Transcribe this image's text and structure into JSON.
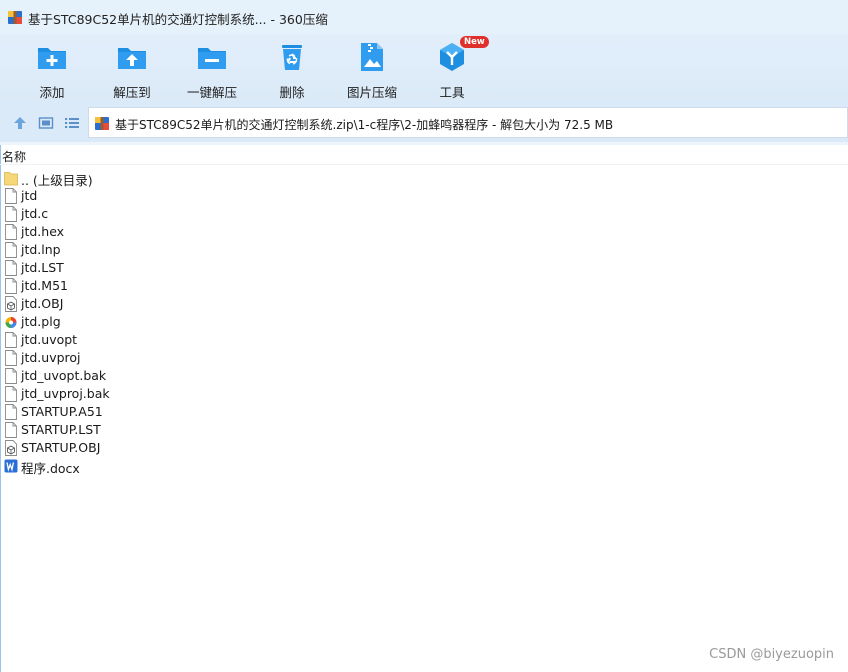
{
  "window": {
    "title": "基于STC89C52单片机的交通灯控制系统... - 360压缩"
  },
  "toolbar": {
    "items": [
      {
        "label": "添加",
        "icon": "add-folder-icon"
      },
      {
        "label": "解压到",
        "icon": "extract-to-icon"
      },
      {
        "label": "一键解压",
        "icon": "one-click-extract-icon"
      },
      {
        "label": "删除",
        "icon": "recycle-bin-icon"
      },
      {
        "label": "图片压缩",
        "icon": "image-compress-icon"
      },
      {
        "label": "工具",
        "icon": "tools-icon"
      }
    ],
    "new_badge": "New"
  },
  "address": {
    "path": "基于STC89C52单片机的交通灯控制系统.zip\\1-c程序\\2-加蜂鸣器程序 - 解包大小为 72.5 MB"
  },
  "columns": {
    "name": "名称"
  },
  "files": [
    {
      "name": ".. (上级目录)",
      "icon": "folder-icon"
    },
    {
      "name": "jtd",
      "icon": "file-icon"
    },
    {
      "name": "jtd.c",
      "icon": "file-icon"
    },
    {
      "name": "jtd.hex",
      "icon": "file-icon"
    },
    {
      "name": "jtd.lnp",
      "icon": "file-icon"
    },
    {
      "name": "jtd.LST",
      "icon": "file-icon"
    },
    {
      "name": "jtd.M51",
      "icon": "file-icon"
    },
    {
      "name": "jtd.OBJ",
      "icon": "obj-file-icon"
    },
    {
      "name": "jtd.plg",
      "icon": "plg-file-icon"
    },
    {
      "name": "jtd.uvopt",
      "icon": "file-icon"
    },
    {
      "name": "jtd.uvproj",
      "icon": "file-icon"
    },
    {
      "name": "jtd_uvopt.bak",
      "icon": "file-icon"
    },
    {
      "name": "jtd_uvproj.bak",
      "icon": "file-icon"
    },
    {
      "name": "STARTUP.A51",
      "icon": "file-icon"
    },
    {
      "name": "STARTUP.LST",
      "icon": "file-icon"
    },
    {
      "name": "STARTUP.OBJ",
      "icon": "obj-file-icon"
    },
    {
      "name": "程序.docx",
      "icon": "word-file-icon"
    }
  ],
  "watermark": "CSDN @biyezuopin",
  "colors": {
    "toolbar_bg": "#dbeaf8",
    "icon_blue": "#1e8fe0",
    "badge_red": "#e0302b"
  }
}
